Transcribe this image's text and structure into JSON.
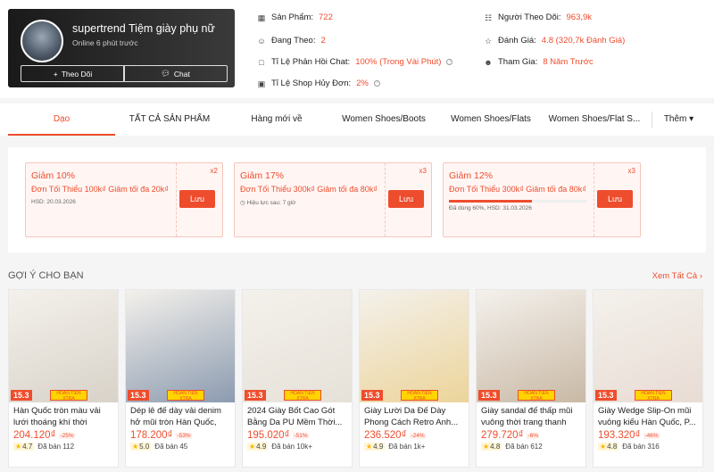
{
  "shop": {
    "name": "supertrend Tiệm giày phụ nữ",
    "online": "Online 6 phút trước",
    "follow_label": "Theo Dõi",
    "chat_label": "Chat"
  },
  "stats": [
    {
      "label": "Sản Phẩm:",
      "value": "722",
      "icon": "store-icon"
    },
    {
      "label": "Đang Theo:",
      "value": "2",
      "icon": "person-icon"
    },
    {
      "label": "Tỉ Lệ Phản Hồi Chat:",
      "value": "100% (Trong Vài Phút)",
      "icon": "chat-icon",
      "help": true
    },
    {
      "label": "Tỉ Lệ Shop Hủy Đơn:",
      "value": "2%",
      "icon": "cart-icon",
      "help": true
    },
    {
      "label": "Người Theo Dõi:",
      "value": "963,9k",
      "icon": "followers-icon"
    },
    {
      "label": "Đánh Giá:",
      "value": "4.8 (320,7k Đánh Giá)",
      "icon": "star-icon"
    },
    {
      "label": "Tham Gia:",
      "value": "8 Năm Trước",
      "icon": "person-add-icon"
    }
  ],
  "nav": {
    "tabs": [
      "Dạo",
      "TẤT CẢ SẢN PHẨM",
      "Hàng mới về",
      "Women Shoes/Boots",
      "Women Shoes/Flats",
      "Women Shoes/Flat S..."
    ],
    "more": "Thêm"
  },
  "vouchers": [
    {
      "title": "Giảm 10%",
      "desc": "Đơn Tối Thiểu 100k₫ Giảm tối đa 20k₫",
      "meta": "HSD: 20.03.2026",
      "mult": "x2",
      "save": "Lưu",
      "progress": null
    },
    {
      "title": "Giảm 17%",
      "desc": "Đơn Tối Thiểu 300k₫ Giảm tối đa 80k₫",
      "meta": "Hiệu lực sau: 7 giờ",
      "mult": "x3",
      "save": "Lưu",
      "progress": null
    },
    {
      "title": "Giảm 12%",
      "desc": "Đơn Tối Thiểu 300k₫ Giảm tối đa 80k₫",
      "meta": "Đã dùng 60%, HSD: 31.03.2026",
      "mult": "x3",
      "save": "Lưu",
      "progress": 0.6
    }
  ],
  "suggest": {
    "title": "GỢI Ý CHO BẠN",
    "see_all": "Xem Tất Cả"
  },
  "products": [
    {
      "name": "Hàn Quốc tròn màu vải lưới thoáng khí thời trang...",
      "price": "204.120₫",
      "discount": "-25%",
      "rating": "4.7",
      "sold": "Đã bán 112",
      "img": "#d8d2c8"
    },
    {
      "name": "Dép lê đế dày vải denim hở mũi tròn Hàn Quốc, Dép l...",
      "price": "178.200₫",
      "discount": "-53%",
      "rating": "5.0",
      "sold": "Đã bán 45",
      "img": "#8c9bb0"
    },
    {
      "name": "2024 Giày Bốt Cao Gót Bằng Da PU Mềm Thời...",
      "price": "195.020₫",
      "discount": "-51%",
      "rating": "4.9",
      "sold": "Đã bán 10k+",
      "img": "#e6e1d8"
    },
    {
      "name": "Giày Lười Da Đế Dày Phong Cách Retro Anh...",
      "price": "236.520₫",
      "discount": "-24%",
      "rating": "4.9",
      "sold": "Đã bán 1k+",
      "img": "#ecd49a"
    },
    {
      "name": "Giày sandal đế thấp mũi vuông thời trang thanh lịc...",
      "price": "279.720₫",
      "discount": "-6%",
      "rating": "4.8",
      "sold": "Đã bán 612",
      "img": "#c9b9a6"
    },
    {
      "name": "Giày Wedge Slip-On mũi vuông kiểu Hàn Quốc, P...",
      "price": "193.320₫",
      "discount": "-46%",
      "rating": "4.8",
      "sold": "Đã bán 316",
      "img": "#e8dcd4"
    }
  ],
  "badge": {
    "sale": "15.3",
    "tag": "HOÀN TIỀN XTRA"
  },
  "colors": {
    "accent": "#ee4d2d"
  }
}
